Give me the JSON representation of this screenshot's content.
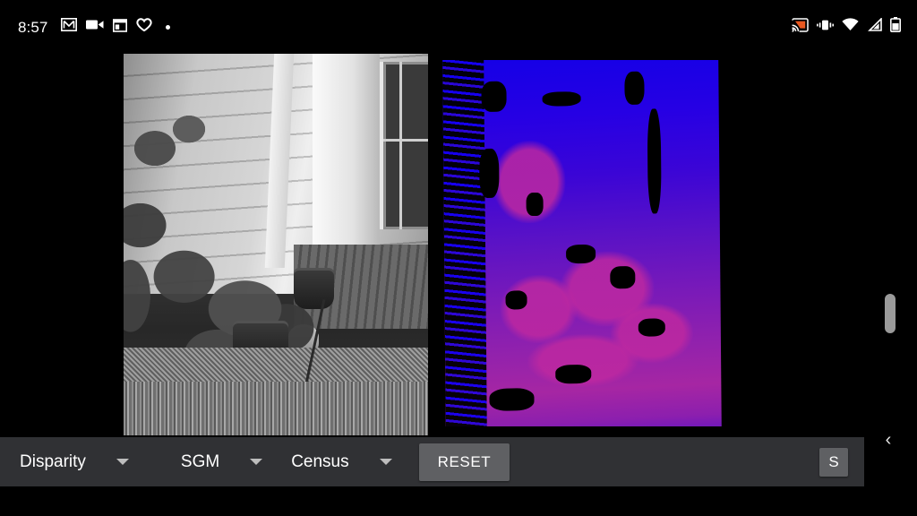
{
  "status_bar": {
    "time": "8:57",
    "left_icons": [
      {
        "name": "gmail-icon",
        "label": "Gmail"
      },
      {
        "name": "video-camera-icon",
        "label": "Video camera"
      },
      {
        "name": "calendar-icon",
        "label": "Calendar"
      },
      {
        "name": "heart-icon",
        "label": "Health"
      },
      {
        "name": "more-dot-icon",
        "label": "More notifications"
      }
    ],
    "right_icons": [
      {
        "name": "cast-icon",
        "label": "Cast",
        "color": "#e8571f"
      },
      {
        "name": "vibrate-icon",
        "label": "Vibrate mode"
      },
      {
        "name": "wifi-icon",
        "label": "Wi-Fi"
      },
      {
        "name": "cell-signal-icon",
        "label": "Cellular signal"
      },
      {
        "name": "battery-icon",
        "label": "Battery"
      }
    ]
  },
  "stage": {
    "left_image": {
      "name": "rectified-stereo-input-image",
      "description": "Grayscale rectified left camera frame: backyard garden with potted plants, wooden siding wall, doorway and deck"
    },
    "right_image": {
      "name": "disparity-result-image",
      "description": "Computed disparity map rendered with a blue-to-magenta colormap; black regions are invalid / occluded pixels",
      "colormap_near": "#a626a3",
      "colormap_far": "#1500e6",
      "invalid_color": "#000000"
    }
  },
  "toolbar": {
    "background": "#303134",
    "spinners": [
      {
        "name": "output-mode-spinner",
        "value": "Disparity"
      },
      {
        "name": "algorithm-spinner",
        "value": "SGM"
      },
      {
        "name": "cost-function-spinner",
        "value": "Census"
      }
    ],
    "reset_label": "RESET",
    "settings_label": "S"
  },
  "navigation": {
    "back_chevron": "‹",
    "scrollbar": {
      "name": "vertical-scrollbar-thumb"
    }
  }
}
